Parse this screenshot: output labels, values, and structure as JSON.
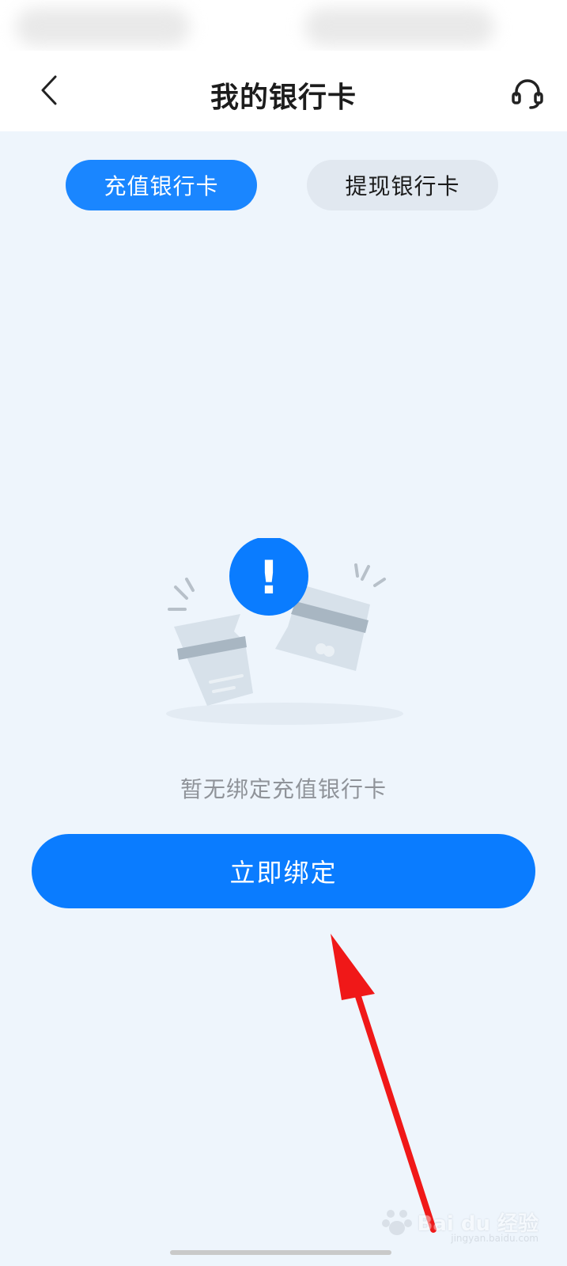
{
  "header": {
    "title": "我的银行卡"
  },
  "tabs": [
    {
      "label": "充值银行卡",
      "active": true
    },
    {
      "label": "提现银行卡",
      "active": false
    }
  ],
  "empty_state": {
    "message": "暂无绑定充值银行卡",
    "alert_symbol": "!"
  },
  "actions": {
    "bind_label": "立即绑定"
  },
  "watermark": {
    "brand": "Bai du 经验",
    "url": "jingyan.baidu.com"
  },
  "colors": {
    "accent": "#0a7cff",
    "tab_active": "#1a86ff",
    "background": "#eef5fc",
    "annotation_arrow": "#f01818"
  },
  "icons": {
    "back": "chevron-left-icon",
    "support": "headset-icon",
    "empty": "broken-card-icon"
  }
}
